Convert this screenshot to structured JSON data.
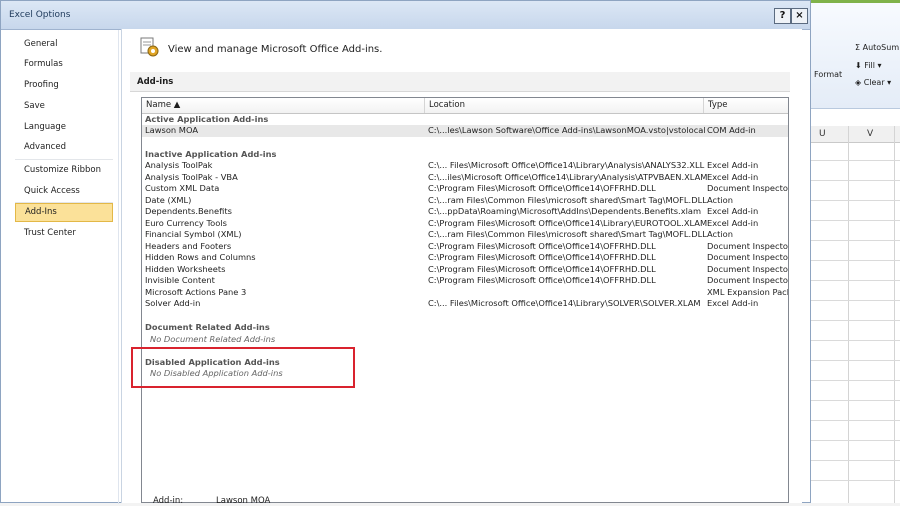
{
  "dialog": {
    "title": "Excel Options",
    "help_label": "?",
    "close_label": "×"
  },
  "nav": {
    "items": [
      "General",
      "Formulas",
      "Proofing",
      "Save",
      "Language",
      "Advanced",
      "Customize Ribbon",
      "Quick Access Toolbar",
      "Add-Ins",
      "Trust Center"
    ],
    "selected": "Add-Ins"
  },
  "panel": {
    "header_text": "View and manage Microsoft Office Add-ins.",
    "section_title": "Add-ins"
  },
  "table": {
    "columns": [
      "Name ▲",
      "Location",
      "Type"
    ],
    "groups": {
      "active": "Active Application Add-ins",
      "inactive": "Inactive Application Add-ins",
      "document": "Document Related Add-ins",
      "document_empty": "No Document Related Add-ins",
      "disabled": "Disabled Application Add-ins",
      "disabled_empty": "No Disabled Application Add-ins"
    },
    "active_rows": [
      {
        "name": "Lawson MOA",
        "location": "C:\\...les\\Lawson Software\\Office Add-ins\\LawsonMOA.vsto|vstolocal",
        "type": "COM Add-in"
      }
    ],
    "inactive_rows": [
      {
        "name": "Analysis ToolPak",
        "location": "C:\\... Files\\Microsoft Office\\Office14\\Library\\Analysis\\ANALYS32.XLL",
        "type": "Excel Add-in"
      },
      {
        "name": "Analysis ToolPak - VBA",
        "location": "C:\\...iles\\Microsoft Office\\Office14\\Library\\Analysis\\ATPVBAEN.XLAM",
        "type": "Excel Add-in"
      },
      {
        "name": "Custom XML Data",
        "location": "C:\\Program Files\\Microsoft Office\\Office14\\OFFRHD.DLL",
        "type": "Document Inspector"
      },
      {
        "name": "Date (XML)",
        "location": "C:\\...ram Files\\Common Files\\microsoft shared\\Smart Tag\\MOFL.DLL",
        "type": "Action"
      },
      {
        "name": "Dependents.Benefits",
        "location": "C:\\...ppData\\Roaming\\Microsoft\\AddIns\\Dependents.Benefits.xlam",
        "type": "Excel Add-in"
      },
      {
        "name": "Euro Currency Tools",
        "location": "C:\\Program Files\\Microsoft Office\\Office14\\Library\\EUROTOOL.XLAM",
        "type": "Excel Add-in"
      },
      {
        "name": "Financial Symbol (XML)",
        "location": "C:\\...ram Files\\Common Files\\microsoft shared\\Smart Tag\\MOFL.DLL",
        "type": "Action"
      },
      {
        "name": "Headers and Footers",
        "location": "C:\\Program Files\\Microsoft Office\\Office14\\OFFRHD.DLL",
        "type": "Document Inspector"
      },
      {
        "name": "Hidden Rows and Columns",
        "location": "C:\\Program Files\\Microsoft Office\\Office14\\OFFRHD.DLL",
        "type": "Document Inspector"
      },
      {
        "name": "Hidden Worksheets",
        "location": "C:\\Program Files\\Microsoft Office\\Office14\\OFFRHD.DLL",
        "type": "Document Inspector"
      },
      {
        "name": "Invisible Content",
        "location": "C:\\Program Files\\Microsoft Office\\Office14\\OFFRHD.DLL",
        "type": "Document Inspector"
      },
      {
        "name": "Microsoft Actions Pane 3",
        "location": "",
        "type": "XML Expansion Pack"
      },
      {
        "name": "Solver Add-in",
        "location": "C:\\... Files\\Microsoft Office\\Office14\\Library\\SOLVER\\SOLVER.XLAM",
        "type": "Excel Add-in"
      }
    ]
  },
  "bottom": {
    "label": "Add-in:",
    "value": "Lawson MOA"
  },
  "excel": {
    "autosum": "AutoSum",
    "fill": "Fill",
    "clear": "Clear",
    "format": "Format",
    "col_u": "U",
    "col_v": "V"
  },
  "colors": {
    "selection": "#fbe199",
    "highlight": "#d9232e"
  }
}
